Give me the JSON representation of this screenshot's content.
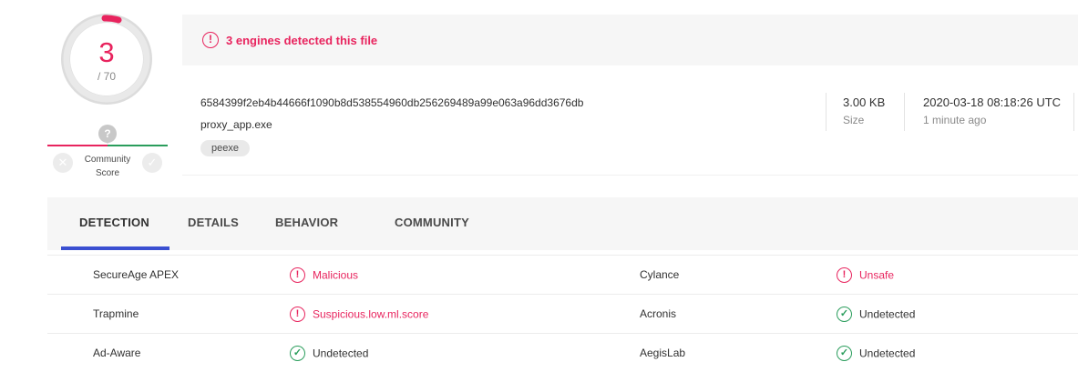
{
  "score": {
    "detections": "3",
    "total": "/ 70",
    "accent_color": "#e8245e"
  },
  "community": {
    "question_icon": "?",
    "label_line1": "Community",
    "label_line2": "Score",
    "downvote_icon": "close-icon",
    "upvote_icon": "check-icon"
  },
  "alert": {
    "icon": "exclamation-icon",
    "text": "3 engines detected this file"
  },
  "file": {
    "hash": "6584399f2eb4b44666f1090b8d538554960db256269489a99e063a96dd3676db",
    "name": "proxy_app.exe",
    "tag": "peexe",
    "size_value": "3.00 KB",
    "size_label": "Size",
    "date_value": "2020-03-18 08:18:26 UTC",
    "date_label": "1 minute ago"
  },
  "tabs": [
    {
      "label": "DETECTION",
      "active": true
    },
    {
      "label": "DETAILS",
      "active": false
    },
    {
      "label": "BEHAVIOR",
      "active": false
    },
    {
      "label": "COMMUNITY",
      "active": false
    }
  ],
  "detections": [
    {
      "engine_left": "SecureAge APEX",
      "result_left": "Malicious",
      "status_left": "malicious",
      "engine_right": "Cylance",
      "result_right": "Unsafe",
      "status_right": "malicious"
    },
    {
      "engine_left": "Trapmine",
      "result_left": "Suspicious.low.ml.score",
      "status_left": "malicious",
      "engine_right": "Acronis",
      "result_right": "Undetected",
      "status_right": "clean"
    },
    {
      "engine_left": "Ad-Aware",
      "result_left": "Undetected",
      "status_left": "clean",
      "engine_right": "AegisLab",
      "result_right": "Undetected",
      "status_right": "clean"
    }
  ],
  "colors": {
    "malicious": "#e8245e",
    "clean": "#2a9d5c",
    "tab_underline": "#3a4fd1"
  }
}
